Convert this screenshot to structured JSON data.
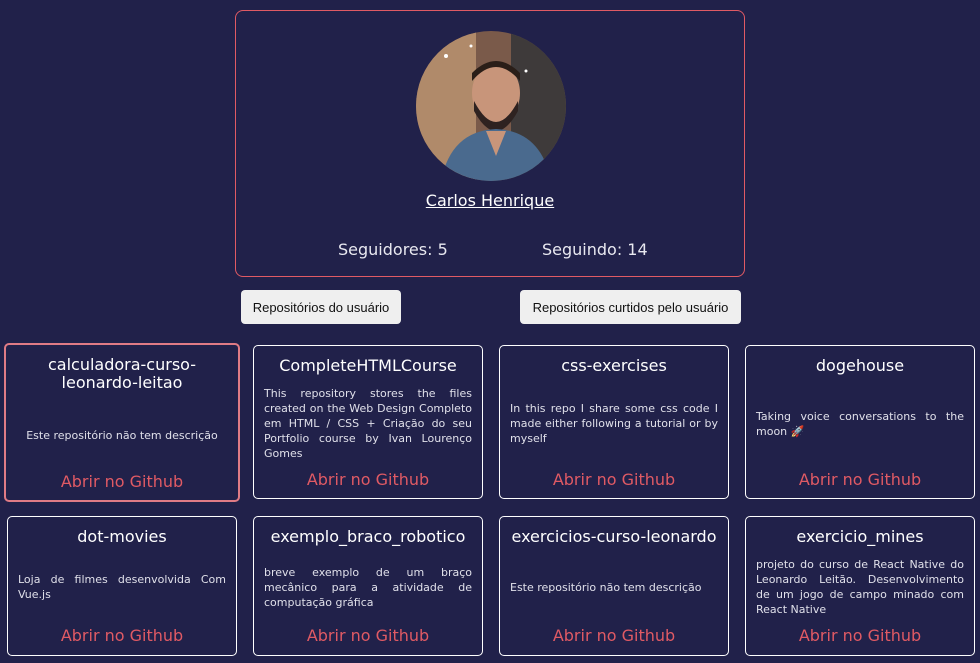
{
  "profile": {
    "name": "Carlos Henrique",
    "followers": "Seguidores: 5",
    "following": "Seguindo: 14"
  },
  "tabs": {
    "user_repos": "Repositórios do usuário",
    "starred_repos": "Repositórios curtidos pelo usuário"
  },
  "repos": [
    {
      "name": "calculadora-curso-leonardo-leitao",
      "description": "Este repositório não tem descrição",
      "link": "Abrir no Github"
    },
    {
      "name": "CompleteHTMLCourse",
      "description": "This repository stores the files created on the Web Design Completo em HTML / CSS + Criação do seu Portfolio course by Ivan Lourenço Gomes",
      "link": "Abrir no Github"
    },
    {
      "name": "css-exercises",
      "description": "In this repo I share some css code I made either following a tutorial or by myself",
      "link": "Abrir no Github"
    },
    {
      "name": "dogehouse",
      "description": "Taking voice conversations to the moon 🚀",
      "link": "Abrir no Github"
    },
    {
      "name": "dot-movies",
      "description": "Loja de filmes desenvolvida Com Vue.js",
      "link": "Abrir no Github"
    },
    {
      "name": "exemplo_braco_robotico",
      "description": "breve exemplo de um braço mecânico para a atividade de computação gráfica",
      "link": "Abrir no Github"
    },
    {
      "name": "exercicios-curso-leonardo",
      "description": "Este repositório não tem descrição",
      "link": "Abrir no Github"
    },
    {
      "name": "exercicio_mines",
      "description": "projeto do curso de React Native do Leonardo Leitão. Desenvolvimento de um jogo de campo minado com React Native",
      "link": "Abrir no Github"
    }
  ],
  "colors": {
    "background": "#21214a",
    "accent": "#e05a64"
  }
}
